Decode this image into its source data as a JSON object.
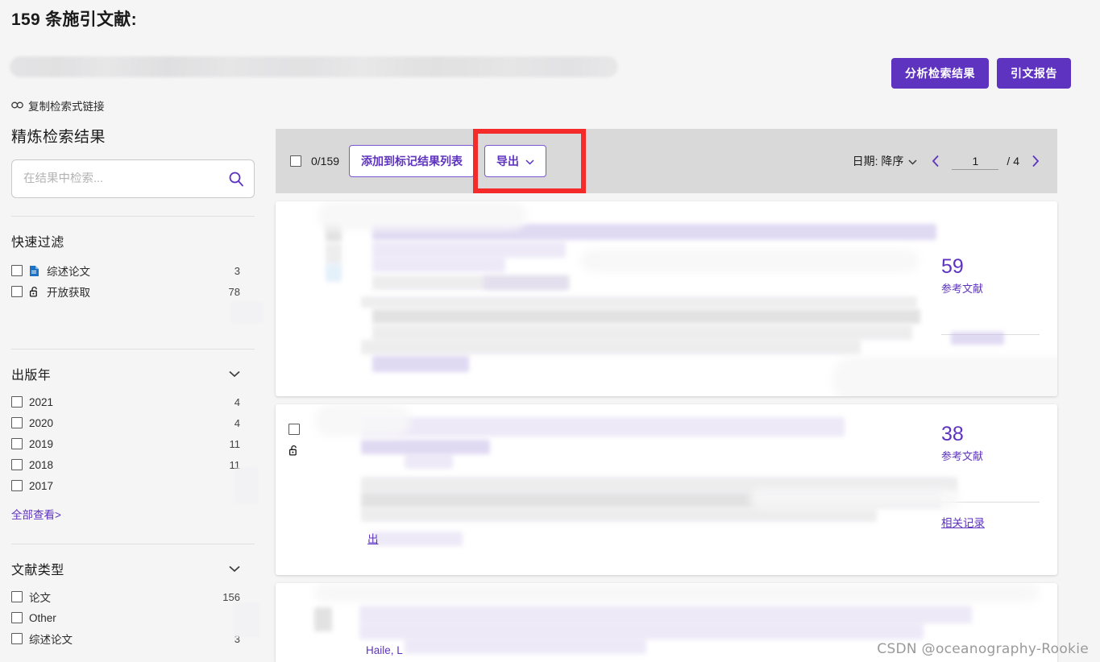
{
  "header": {
    "title": "159 条施引文献:",
    "query_redacted": true,
    "copy_link_label": "复制检索式链接",
    "analyze_button": "分析检索结果",
    "citation_report_button": "引文报告"
  },
  "sidebar": {
    "title": "精炼检索结果",
    "search": {
      "placeholder": "在结果中检索...",
      "value": "",
      "icon": "search-icon"
    },
    "quick_filter": {
      "title": "快速过滤",
      "items": [
        {
          "label": "综述论文",
          "count": "3",
          "icon": "document-icon"
        },
        {
          "label": "开放获取",
          "count": "78",
          "icon": "open-lock-icon"
        }
      ]
    },
    "publication_year": {
      "title": "出版年",
      "collapse_icon": "chevron-down-icon",
      "items": [
        {
          "label": "2021",
          "count": "4"
        },
        {
          "label": "2020",
          "count": "4"
        },
        {
          "label": "2019",
          "count": "11"
        },
        {
          "label": "2018",
          "count": "11"
        },
        {
          "label": "2017",
          "count": ""
        }
      ],
      "view_all": "全部查看",
      "view_all_chevron": ">"
    },
    "document_type": {
      "title": "文献类型",
      "collapse_icon": "chevron-down-icon",
      "items": [
        {
          "label": "论文",
          "count": "156"
        },
        {
          "label": "Other",
          "count": ""
        },
        {
          "label": "综述论文",
          "count": "3"
        }
      ]
    }
  },
  "toolbar": {
    "select_all_count": "0/159",
    "add_to_marked_list": "添加到标记结果列表",
    "export_label": "导出",
    "export_chevron_icon": "chevron-down-icon",
    "sort_label": "日期: 降序",
    "sort_chevron_icon": "chevron-down-icon",
    "prev_icon": "chevron-left-icon",
    "next_icon": "chevron-right-icon",
    "page_value": "1",
    "page_total": "/ 4",
    "annotation": {
      "color": "#f52a2a",
      "target": "export-button"
    }
  },
  "results": [
    {
      "index": 1,
      "redacted": true,
      "ref_count": "59",
      "ref_label": "参考文献",
      "has_related_records": false,
      "open_access": false
    },
    {
      "index": 2,
      "redacted": true,
      "ref_count": "38",
      "ref_label": "参考文献",
      "related_records_label": "相关记录",
      "has_related_records": true,
      "open_access": true,
      "fulltext_fragment": "出"
    },
    {
      "index": 3,
      "redacted": true,
      "author_fragment": "Haile, L",
      "has_related_records": false,
      "open_access": false
    }
  ],
  "watermark": "CSDN @oceanography-Rookie",
  "colors": {
    "accent_purple": "#5e33bf",
    "annotation_red": "#f52a2a",
    "toolbar_gray": "#d9d9d9",
    "page_bg": "#f5f5f5",
    "doc_icon_blue": "#1a73c4"
  }
}
